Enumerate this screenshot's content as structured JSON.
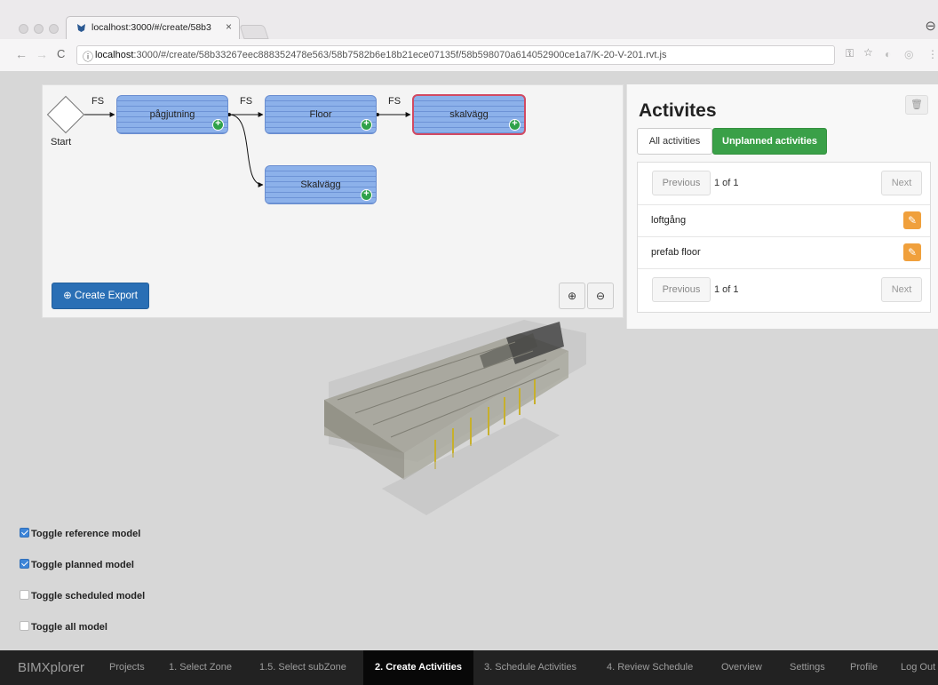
{
  "browser": {
    "tab_title": "localhost:3000/#/create/58b3",
    "tab_close": "×",
    "url_host": "localhost",
    "url_rest": ":3000/#/create/58b33267eec888352478e563/58b7582b6e18b21ece07135f/58b598070a614052900ce1a7/K-20-V-201.rvt.js",
    "back": "←",
    "forward": "→",
    "reload": "C"
  },
  "network": {
    "start_label": "Start",
    "edge_label": "FS",
    "nodes": [
      {
        "label": "pågjutning",
        "plus": "+"
      },
      {
        "label": "Floor",
        "plus": "+"
      },
      {
        "label": "skalvägg",
        "plus": "+"
      },
      {
        "label": "Skalvägg",
        "plus": "+"
      }
    ],
    "create_export_label": "Create Export",
    "zoom_in": "⊕",
    "zoom_out": "⊖"
  },
  "activities": {
    "title": "Activites",
    "tabs": [
      {
        "label": "All activities",
        "active": false
      },
      {
        "label": "Unplanned activities",
        "active": true
      }
    ],
    "pager": {
      "previous": "Previous",
      "count": "1 of 1",
      "next": "Next"
    },
    "items": [
      {
        "name": "loftgång"
      },
      {
        "name": "prefab floor"
      }
    ]
  },
  "toggles": [
    {
      "label": "Toggle reference model",
      "checked": true
    },
    {
      "label": "Toggle planned model",
      "checked": true
    },
    {
      "label": "Toggle scheduled model",
      "checked": false
    },
    {
      "label": "Toggle all model",
      "checked": false
    }
  ],
  "navbar": {
    "brand": "BIMXplorer",
    "items": [
      {
        "label": "Projects",
        "active": false
      },
      {
        "label": "1. Select Zone",
        "active": false
      },
      {
        "label": "1.5. Select subZone",
        "active": false
      },
      {
        "label": "2. Create Activities",
        "active": true
      },
      {
        "label": "3. Schedule Activities",
        "active": false
      },
      {
        "label": "4. Review Schedule",
        "active": false
      },
      {
        "label": "Overview",
        "active": false
      },
      {
        "label": "Settings",
        "active": false
      },
      {
        "label": "Profile",
        "active": false
      },
      {
        "label": "Log Out",
        "active": false
      }
    ]
  },
  "colors": {
    "node_fill": "#8cb1ea",
    "node_selected_border": "#d24a62",
    "primary_button": "#2a6fb5",
    "success": "#3aa048",
    "warning": "#f0a03c",
    "navbar": "#222222"
  }
}
